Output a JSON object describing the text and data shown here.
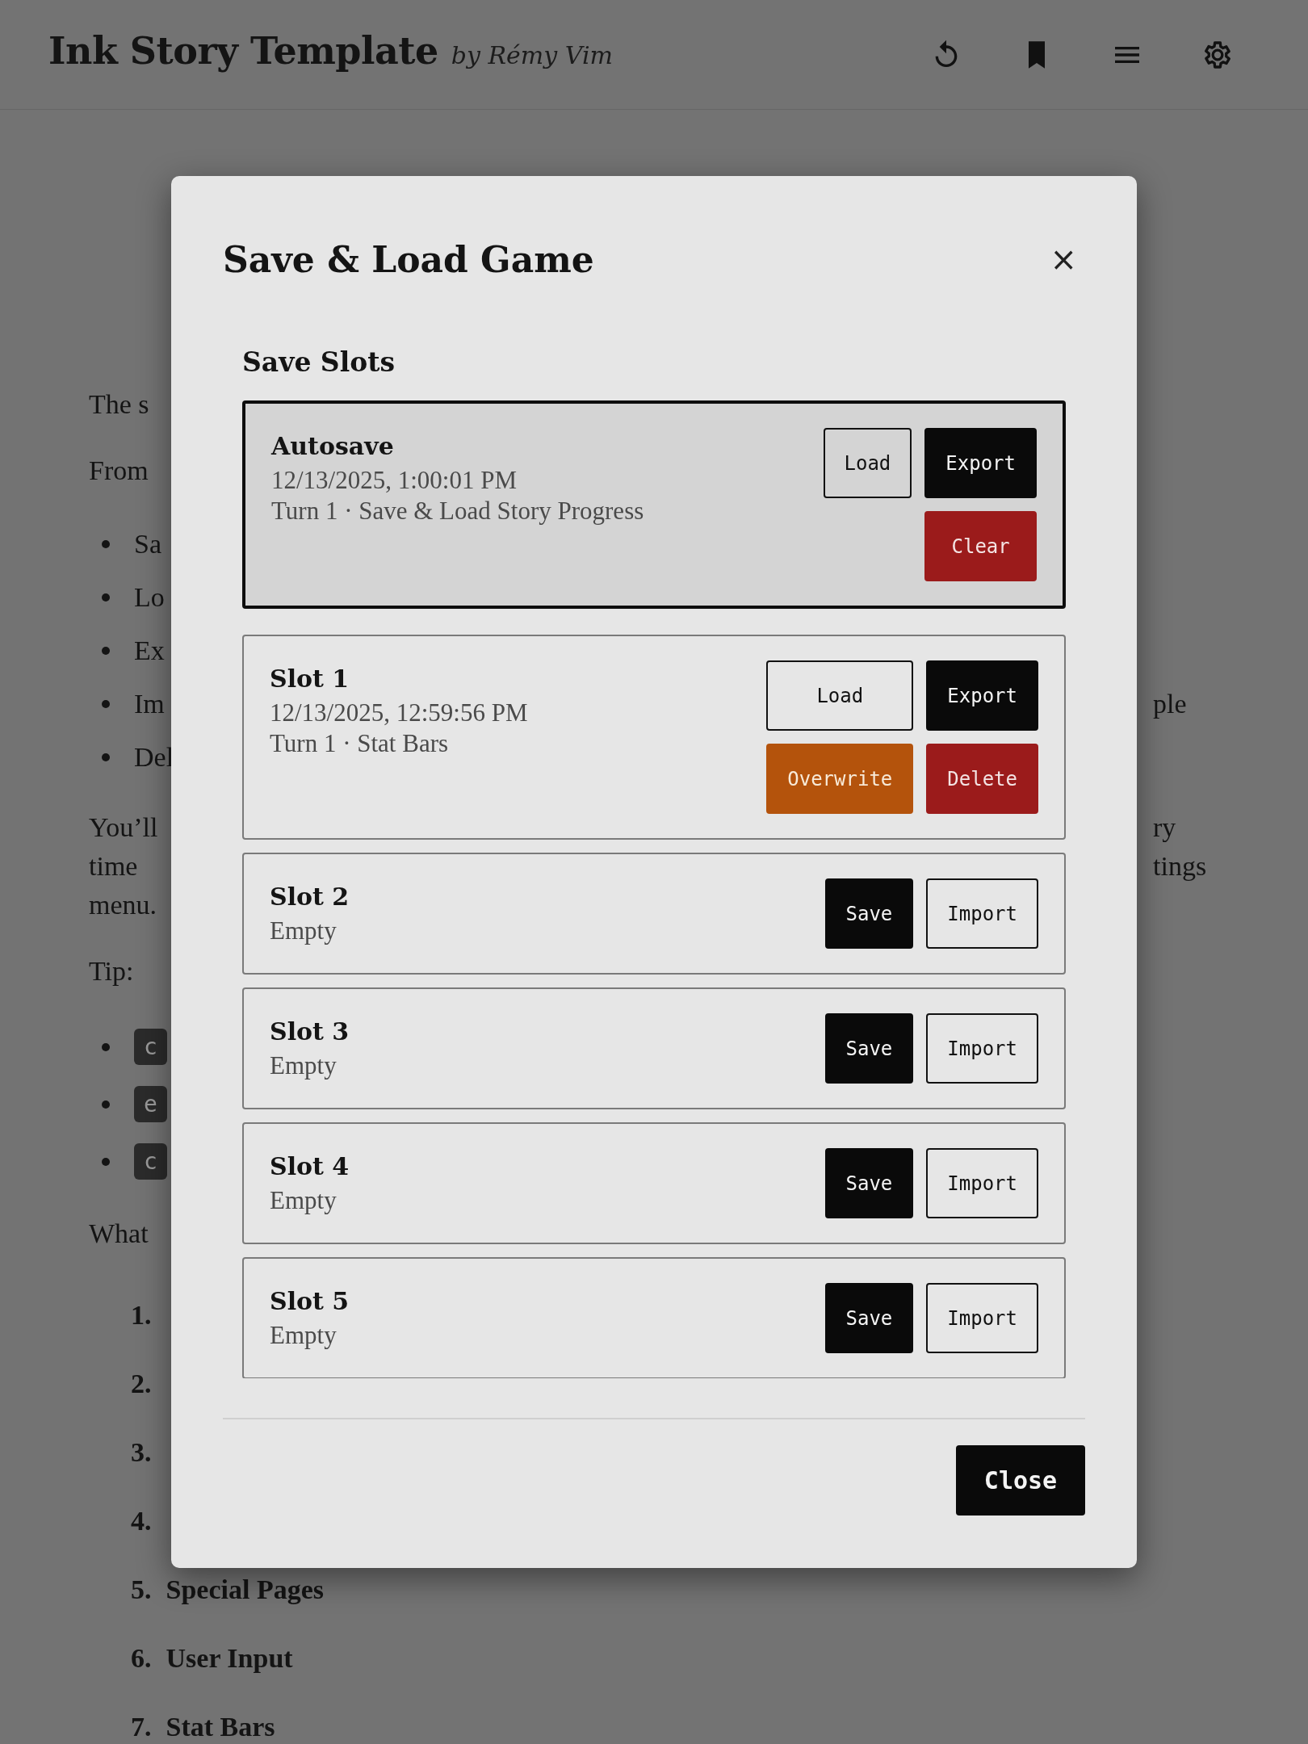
{
  "header": {
    "title": "Ink Story Template",
    "byline": "by Rémy Vim"
  },
  "story": [
    {
      "kind": "paragraph",
      "lines": [
        {
          "text": "The s"
        }
      ]
    },
    {
      "kind": "paragraph",
      "lines": [
        {
          "text": "From"
        }
      ]
    },
    {
      "kind": "bullets",
      "items": [
        {
          "text": "Sa"
        },
        {
          "text": "Lo"
        },
        {
          "text": "Ex"
        },
        {
          "text": "Im",
          "text_right": "ple"
        },
        {
          "text": "Del"
        }
      ]
    },
    {
      "kind": "paragraph",
      "lines": [
        {
          "text": "You’ll",
          "text_right": "ry"
        },
        {
          "text": "time",
          "text_right": "tings"
        },
        {
          "text": "menu."
        }
      ]
    },
    {
      "kind": "paragraph",
      "lines": [
        {
          "text": "Tip:"
        }
      ]
    },
    {
      "kind": "code_bullets",
      "items": [
        {
          "text": "c"
        },
        {
          "text": "e"
        },
        {
          "text": "c"
        }
      ]
    },
    {
      "kind": "paragraph",
      "lines": [
        {
          "text": "What"
        }
      ]
    },
    {
      "kind": "numbered",
      "items": [
        {
          "number": "1."
        },
        {
          "number": "2."
        },
        {
          "number": "3."
        },
        {
          "number": "4."
        },
        {
          "number": "5.",
          "text": "Special Pages"
        },
        {
          "number": "6.",
          "text": "User Input"
        },
        {
          "number": "7.",
          "text": "Stat Bars"
        }
      ]
    }
  ],
  "modal": {
    "title": "Save & Load Game",
    "close_icon": "×",
    "section_title": "Save Slots",
    "slots": [
      {
        "name": "Autosave",
        "date": "12/13/2025, 1:00:01 PM",
        "detail": "Turn 1 · Save & Load Story Progress",
        "highlighted": true,
        "button_rows": [
          [
            {
              "label": "Load",
              "kind": "outline"
            },
            {
              "label": "Export",
              "kind": "primary"
            }
          ],
          [
            {
              "label": "Clear",
              "kind": "danger"
            }
          ]
        ]
      },
      {
        "name": "Slot 1",
        "date": "12/13/2025, 12:59:56 PM",
        "detail": "Turn 1 · Stat Bars",
        "highlighted": false,
        "button_rows": [
          [
            {
              "label": "Load",
              "kind": "outline"
            },
            {
              "label": "Export",
              "kind": "primary"
            }
          ],
          [
            {
              "label": "Overwrite",
              "kind": "warning"
            },
            {
              "label": "Delete",
              "kind": "danger"
            }
          ]
        ]
      },
      {
        "name": "Slot 2",
        "status": "Empty",
        "highlighted": false,
        "button_rows": [
          [
            {
              "label": "Save",
              "kind": "primary"
            },
            {
              "label": "Import",
              "kind": "outline"
            }
          ]
        ]
      },
      {
        "name": "Slot 3",
        "status": "Empty",
        "highlighted": false,
        "button_rows": [
          [
            {
              "label": "Save",
              "kind": "primary"
            },
            {
              "label": "Import",
              "kind": "outline"
            }
          ]
        ]
      },
      {
        "name": "Slot 4",
        "status": "Empty",
        "highlighted": false,
        "button_rows": [
          [
            {
              "label": "Save",
              "kind": "primary"
            },
            {
              "label": "Import",
              "kind": "outline"
            }
          ]
        ]
      },
      {
        "name": "Slot 5",
        "status": "Empty",
        "highlighted": false,
        "button_rows": [
          [
            {
              "label": "Save",
              "kind": "primary"
            },
            {
              "label": "Import",
              "kind": "outline"
            }
          ]
        ]
      }
    ],
    "footer_button": "Close"
  }
}
